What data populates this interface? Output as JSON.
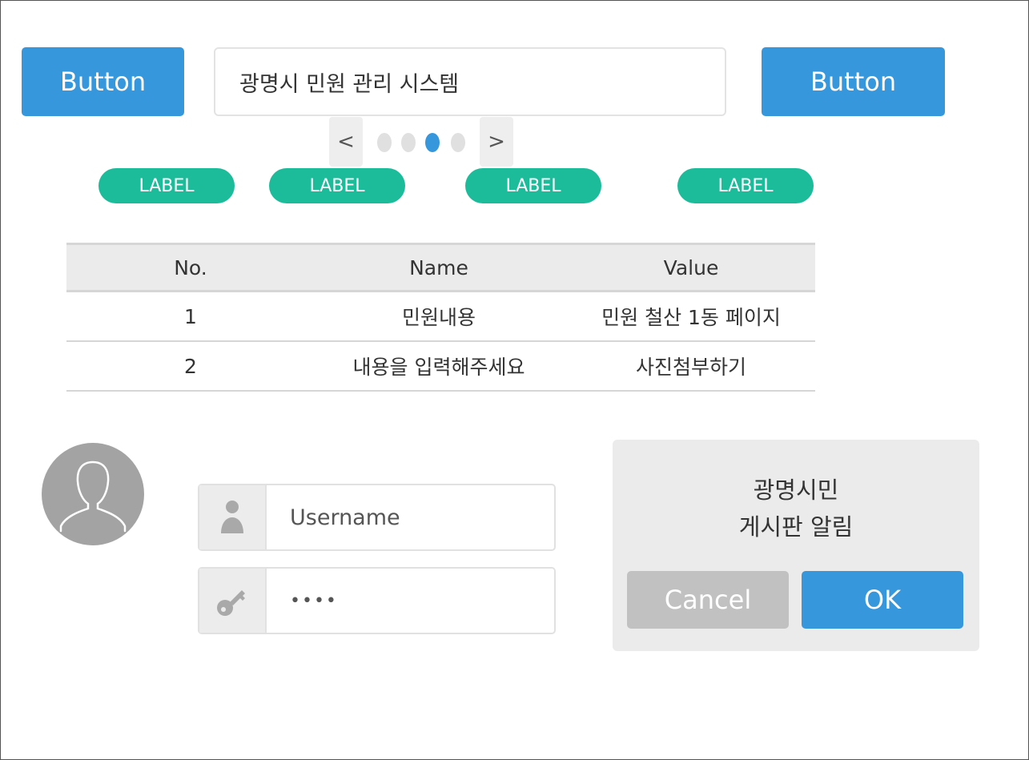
{
  "header": {
    "left_button_label": "Button",
    "title_input_value": "광명시 민원 관리 시스템",
    "right_button_label": "Button"
  },
  "pager": {
    "prev_label": "<",
    "next_label": ">",
    "page_count": 4,
    "active_index": 2
  },
  "labels": [
    "LABEL",
    "LABEL",
    "LABEL",
    "LABEL"
  ],
  "table": {
    "headers": [
      "No.",
      "Name",
      "Value"
    ],
    "rows": [
      [
        "1",
        "민원내용",
        "민원 철산 1동 페이지"
      ],
      [
        "2",
        "내용을 입력해주세요",
        "사진첨부하기"
      ]
    ]
  },
  "login": {
    "username_placeholder": "Username",
    "password_value": "••••"
  },
  "dialog": {
    "line1": "광명시민",
    "line2": "게시판 알림",
    "cancel_label": "Cancel",
    "ok_label": "OK"
  },
  "colors": {
    "primary": "#3797dd",
    "label": "#1cbc9b",
    "cancel": "#c1c1c1"
  }
}
